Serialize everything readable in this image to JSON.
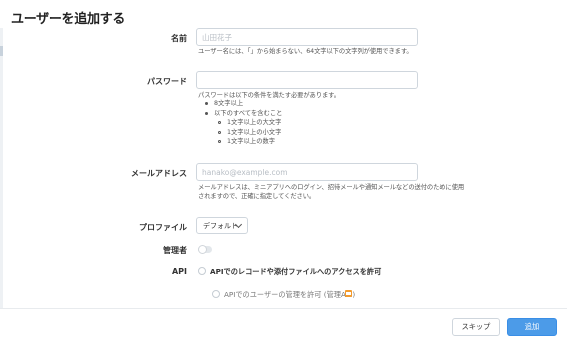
{
  "dialog": {
    "title": "ユーザーを追加する"
  },
  "name": {
    "label": "名前",
    "placeholder": "山田花子",
    "help": "ユーザー名には、「」から始まらない、64文字以下の文字列が使用できます。"
  },
  "password": {
    "label": "パスワード",
    "value": "",
    "help": "パスワードは以下の条件を満たす必要があります。",
    "rules": [
      "8文字以上",
      "以下のすべてを含むこと"
    ],
    "sub_rules": [
      "1文字以上の大文字",
      "1文字以上の小文字",
      "1文字以上の数字"
    ]
  },
  "email": {
    "label": "メールアドレス",
    "placeholder": "hanako@example.com",
    "help_line1": "メールアドレスは、ミニアプリへのログイン、招待メールや通知メールなどの送付のために使用",
    "help_line2": "されますので、正確に指定してください。"
  },
  "profile": {
    "label": "プロファイル",
    "selected": "デフォルト"
  },
  "admin": {
    "label": "管理者",
    "enabled": false
  },
  "api": {
    "label": "API",
    "option1": "APIでのレコードや添付ファイルへのアクセスを許可",
    "option2": "APIでのユーザーの管理を許可 (管理API)"
  },
  "footer": {
    "skip_label": "スキップ",
    "add_label": "追加"
  },
  "colors": {
    "primary": "#4c9be8",
    "badge": "#f39b2d"
  }
}
